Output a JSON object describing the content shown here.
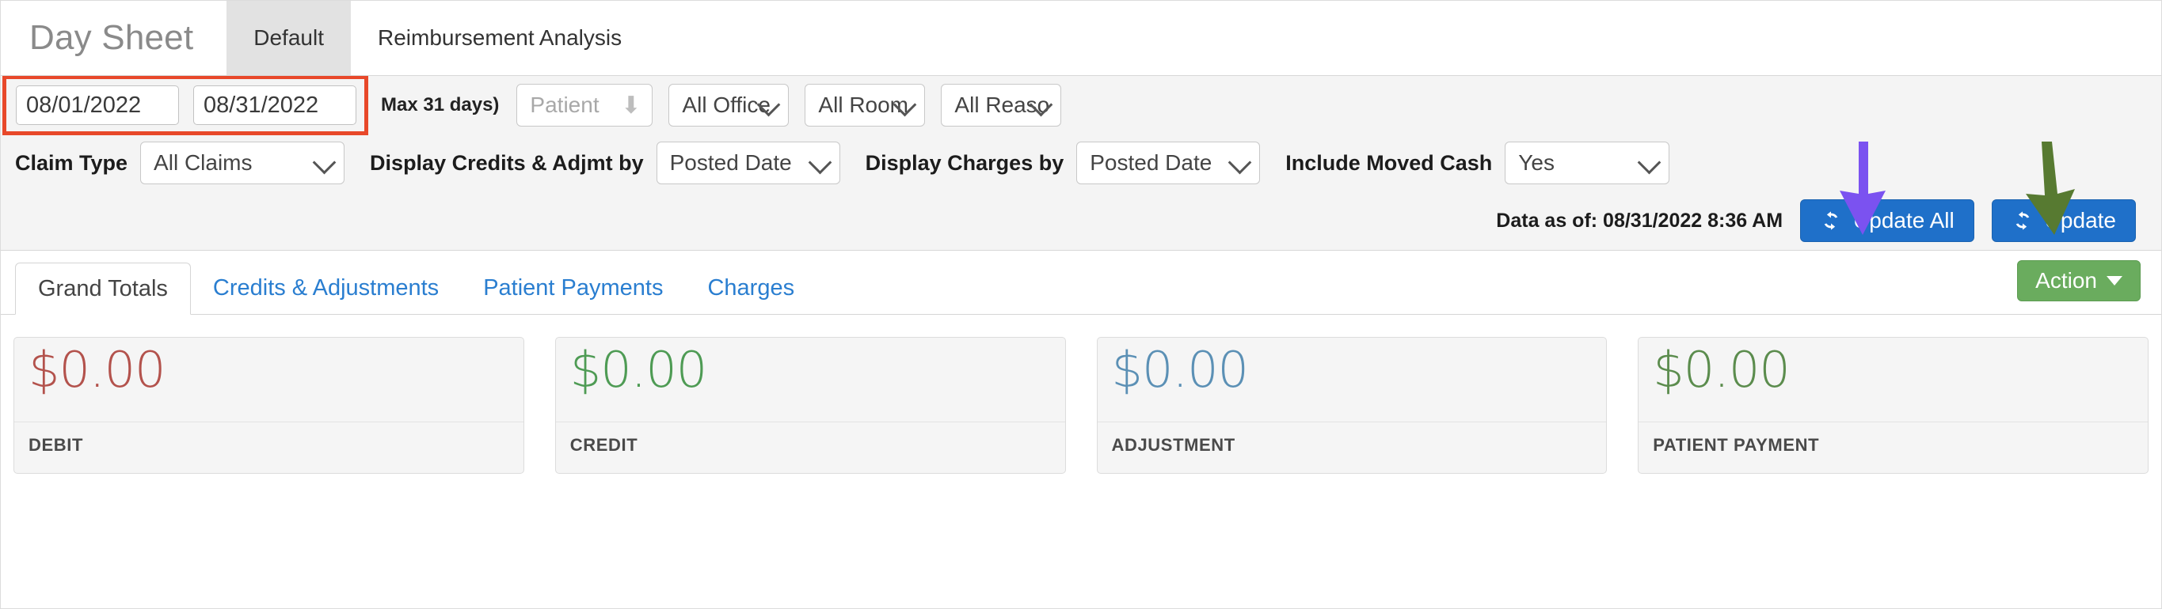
{
  "app": {
    "title": "Day Sheet"
  },
  "top_tabs": [
    {
      "label": "Default",
      "active": true
    },
    {
      "label": "Reimbursement Analysis",
      "active": false
    }
  ],
  "filters": {
    "date_from": {
      "value": "08/01/2022",
      "placeholder": "mm/dd/yyyy"
    },
    "date_to": {
      "value": "08/31/2022",
      "placeholder": "mm/dd/yyyy"
    },
    "max_days_note": "Max 31 days)",
    "patient": {
      "placeholder": "Patient",
      "value": ""
    },
    "office": {
      "value": "All Office"
    },
    "room": {
      "value": "All Room"
    },
    "reason": {
      "value": "All Reaso"
    },
    "claim_type": {
      "label": "Claim Type",
      "value": "All Claims"
    },
    "display_credits_by": {
      "label": "Display Credits & Adjmt by",
      "value": "Posted Date"
    },
    "display_charges_by": {
      "label": "Display Charges by",
      "value": "Posted Date"
    },
    "include_moved_cash": {
      "label": "Include Moved Cash",
      "value": "Yes"
    }
  },
  "update_bar": {
    "data_as_of": "Data as of: 08/31/2022 8:36 AM",
    "update_all_label": "Update All",
    "update_label": "Update"
  },
  "content_tabs": [
    {
      "label": "Grand Totals",
      "active": true
    },
    {
      "label": "Credits & Adjustments",
      "active": false
    },
    {
      "label": "Patient Payments",
      "active": false
    },
    {
      "label": "Charges",
      "active": false
    }
  ],
  "action_button": {
    "label": "Action"
  },
  "cards": [
    {
      "value": "$0.00",
      "label": "DEBIT",
      "color": "#b3524c"
    },
    {
      "value": "$0.00",
      "label": "CREDIT",
      "color": "#4e9b54"
    },
    {
      "value": "$0.00",
      "label": "ADJUSTMENT",
      "color": "#5b90b5"
    },
    {
      "value": "$0.00",
      "label": "PATIENT PAYMENT",
      "color": "#5b8c4d"
    }
  ],
  "annotations": {
    "highlight_box_color": "#e8482a",
    "arrow_update_all_color": "#7b52f0",
    "arrow_update_color": "#577a31"
  }
}
